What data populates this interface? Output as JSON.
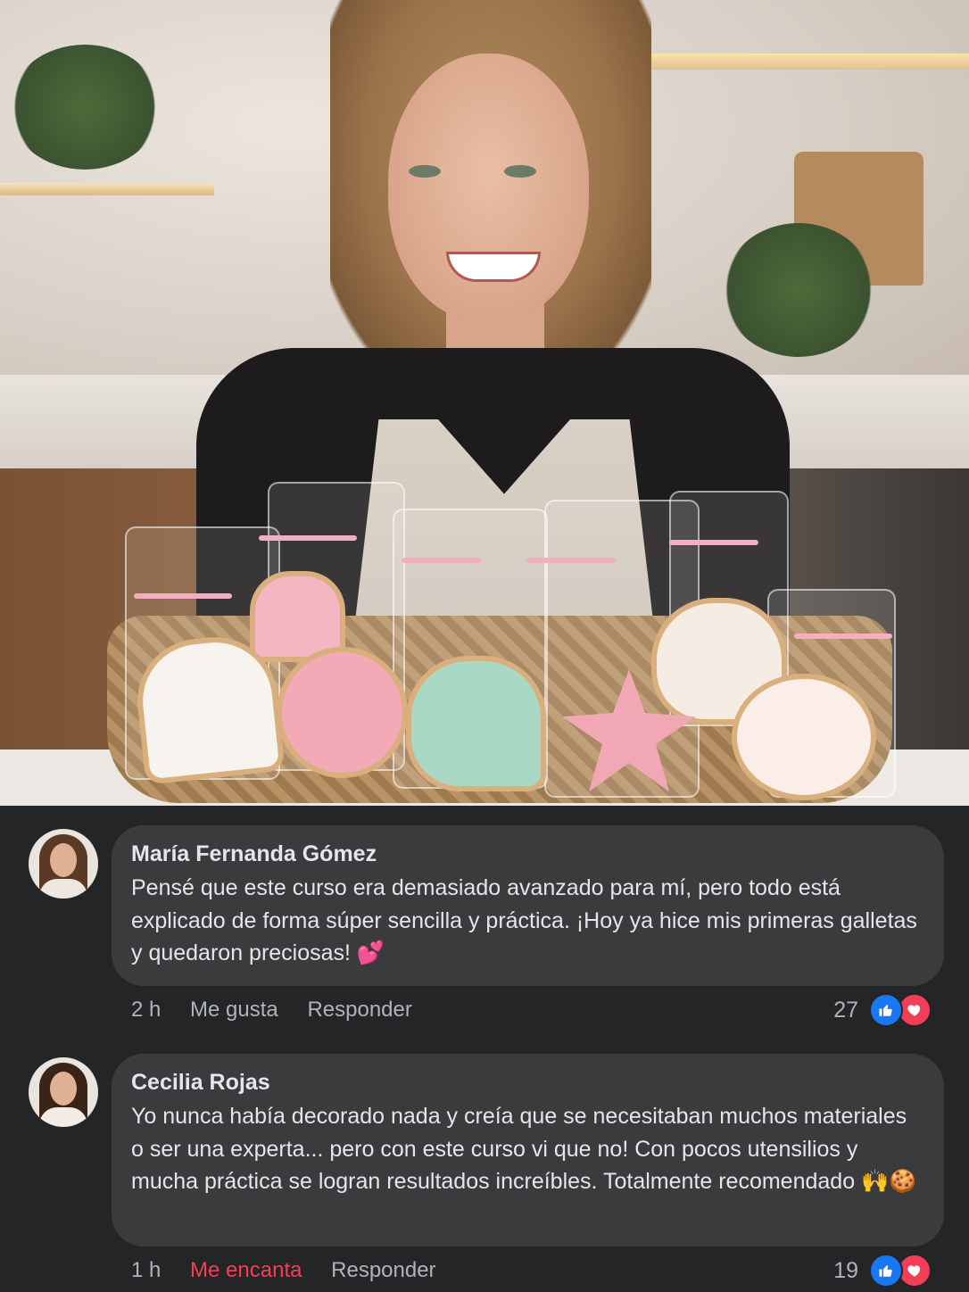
{
  "post": {
    "photo_icon": "photo-woman-with-decorated-cookies"
  },
  "comments": [
    {
      "author": "María Fernanda Gómez",
      "text": "Pensé que este curso era demasiado avanzado para mí, pero todo está explicado de forma súper sencilla y práctica. ¡Hoy ya hice mis primeras galletas y quedaron preciosas! 💕",
      "time": "2 h",
      "like_label": "Me gusta",
      "reply_label": "Responder",
      "reaction_count": "27",
      "reaction_state": "none"
    },
    {
      "author": "Cecilia Rojas",
      "text": "Yo nunca había decorado nada y creía que se necesitaban muchos materiales o ser una experta... pero con este curso vi que no! Con pocos utensilios y mucha práctica se logran resultados increíbles. Totalmente recomendado 🙌🍪",
      "time": "1 h",
      "like_label": "Me encanta",
      "reply_label": "Responder",
      "reaction_count": "19",
      "reaction_state": "love"
    }
  ],
  "colors": {
    "background": "#242526",
    "bubble": "#3a3b3c",
    "text": "#e4e6eb",
    "muted": "#b0b3b8",
    "like_blue": "#1877f2",
    "love_red": "#f33e58"
  },
  "icons": [
    "thumbs-up-icon",
    "heart-icon"
  ]
}
